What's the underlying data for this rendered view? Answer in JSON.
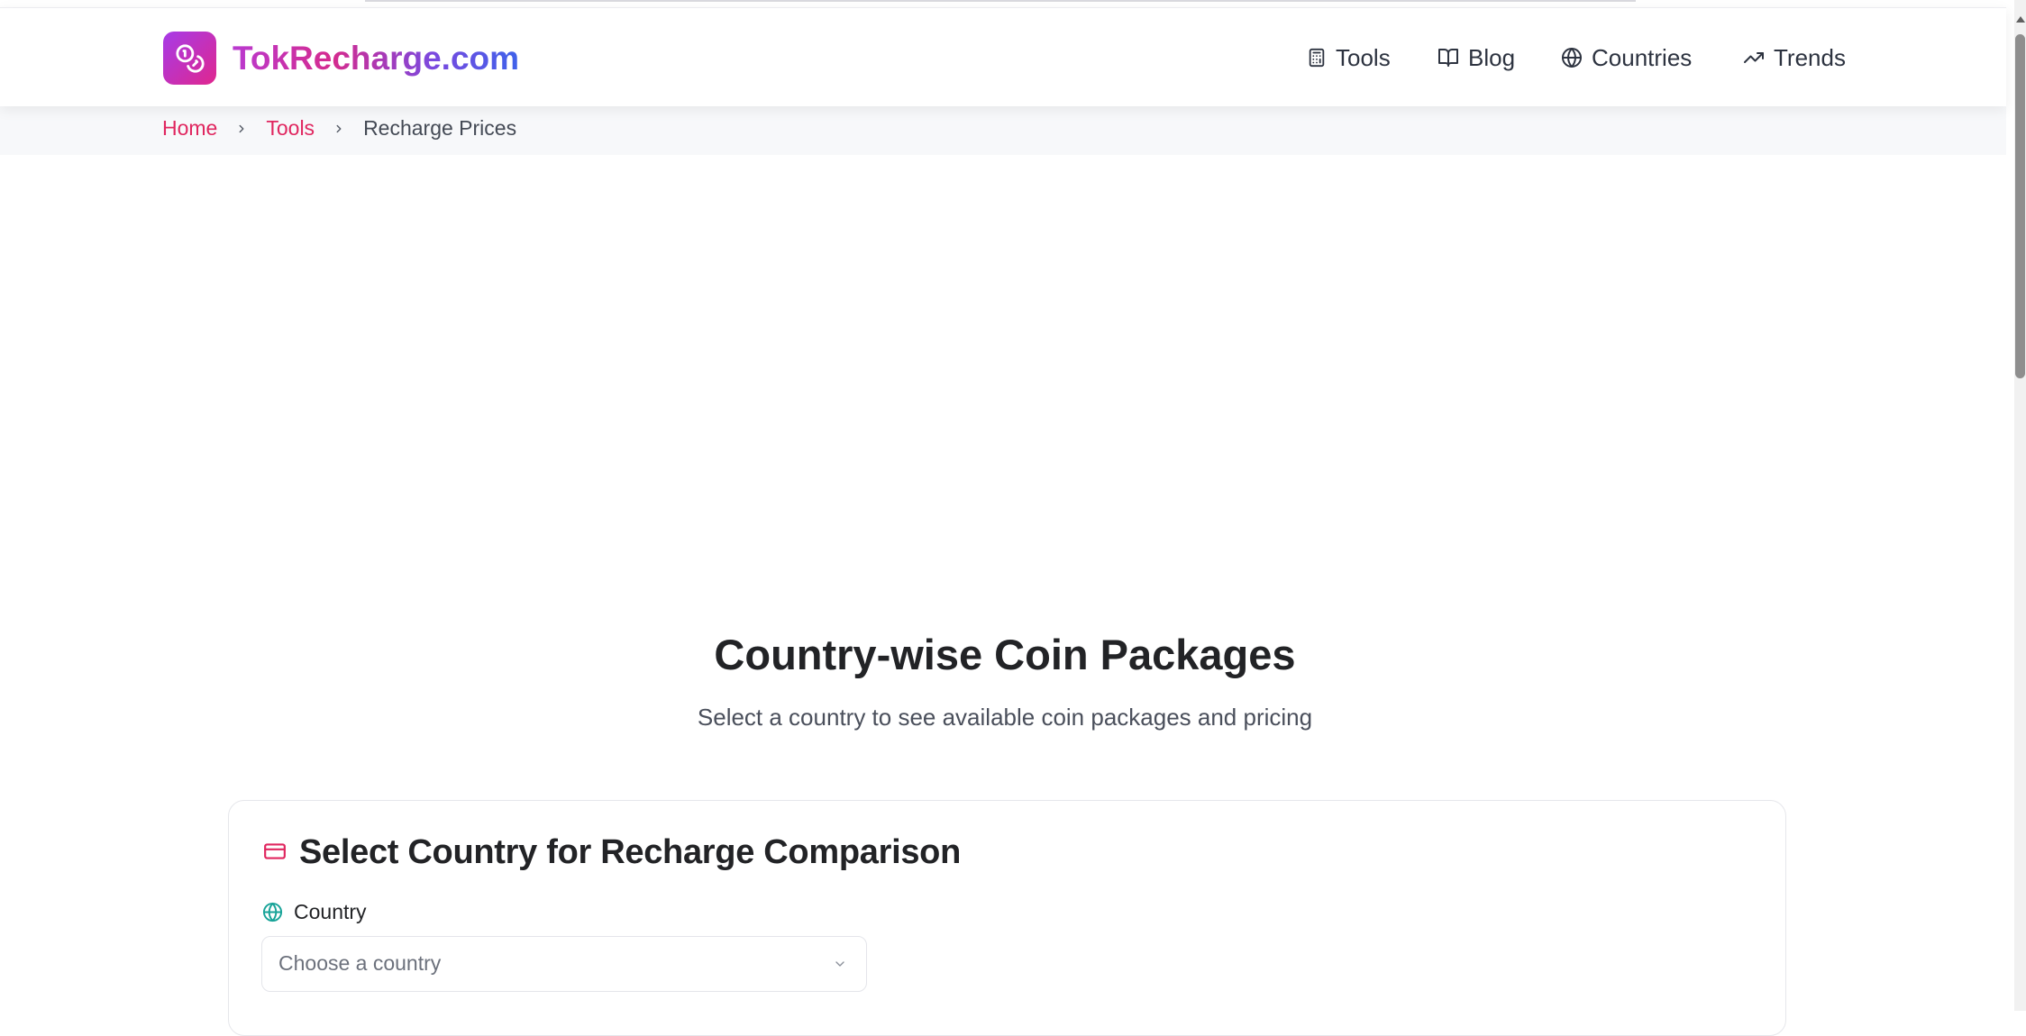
{
  "header": {
    "logo_text": "TokRecharge.com",
    "nav": [
      {
        "label": "Tools",
        "icon": "calculator-icon"
      },
      {
        "label": "Blog",
        "icon": "book-icon"
      },
      {
        "label": "Countries",
        "icon": "globe-icon"
      },
      {
        "label": "Trends",
        "icon": "trending-up-icon"
      }
    ]
  },
  "breadcrumb": {
    "items": [
      "Home",
      "Tools",
      "Recharge Prices"
    ]
  },
  "main": {
    "title": "Country-wise Coin Packages",
    "subtitle": "Select a country to see available coin packages and pricing"
  },
  "card": {
    "title": "Select Country for Recharge Comparison",
    "title_icon": "credit-card-icon",
    "country_label": "Country",
    "country_icon": "globe-icon",
    "select_placeholder": "Choose a country"
  },
  "colors": {
    "accent": "#e0265f",
    "brand_purple": "#a63be8",
    "brand_blue": "#3e62ea",
    "teal_icon": "#17a398"
  }
}
